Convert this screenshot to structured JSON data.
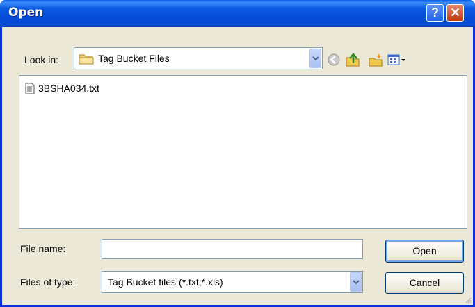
{
  "window": {
    "title": "Open"
  },
  "titlebar": {
    "help_label": "?",
    "close_label": "✕"
  },
  "lookin": {
    "label": "Look in:",
    "value": "Tag Bucket Files"
  },
  "toolbar": {
    "icons": [
      "back-icon",
      "up-folder-icon",
      "new-folder-icon",
      "view-menu-icon"
    ]
  },
  "files": [
    {
      "name": "3BSHA034.txt",
      "icon": "text-file-icon"
    }
  ],
  "filename": {
    "label": "File name:",
    "value": ""
  },
  "filetype": {
    "label": "Files of type:",
    "value": "Tag Bucket files (*.txt;*.xls)"
  },
  "buttons": {
    "open": "Open",
    "cancel": "Cancel"
  },
  "colors": {
    "titlebar": "#0a5fea",
    "dialog_bg": "#ece9d8",
    "border": "#7f9db9"
  }
}
